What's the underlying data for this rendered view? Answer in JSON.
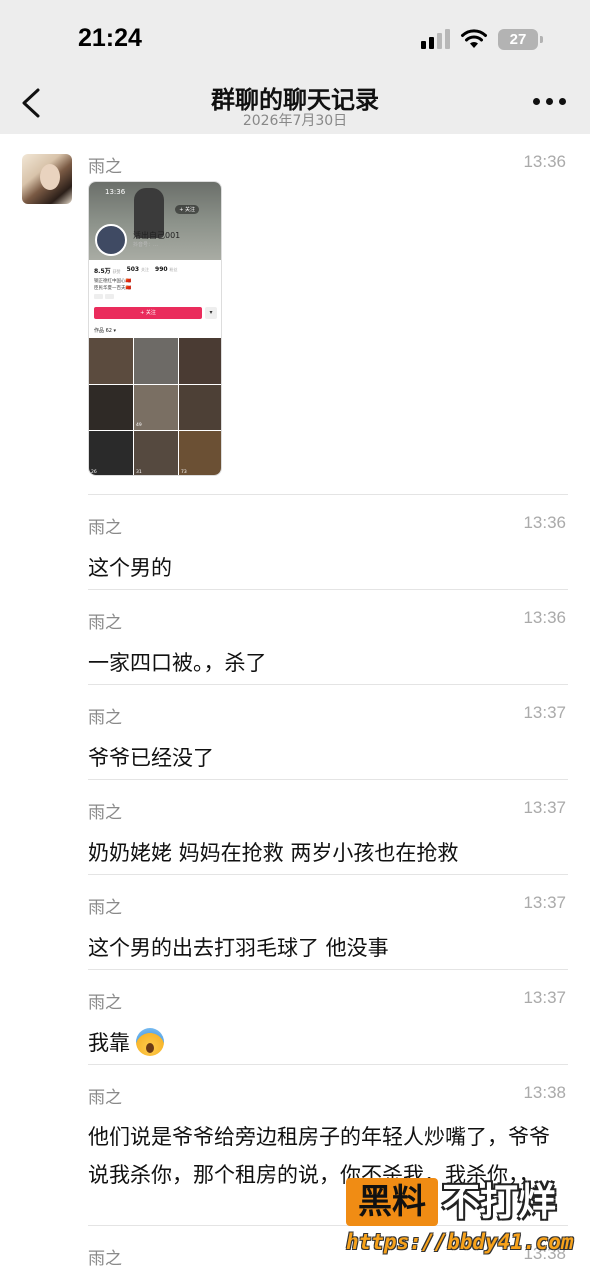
{
  "status_bar": {
    "time": "21:24",
    "battery": "27"
  },
  "header": {
    "title": "群聊的聊天记录",
    "date": "2026年7月30日"
  },
  "messages": [
    {
      "sender": "雨之",
      "time": "13:36",
      "type": "image"
    },
    {
      "sender": "雨之",
      "time": "13:36",
      "text": "这个男的"
    },
    {
      "sender": "雨之",
      "time": "13:36",
      "text": "一家四口被。，杀了"
    },
    {
      "sender": "雨之",
      "time": "13:37",
      "text": "爷爷已经没了"
    },
    {
      "sender": "雨之",
      "time": "13:37",
      "text": "奶奶姥姥 妈妈在抢救 两岁小孩也在抢救"
    },
    {
      "sender": "雨之",
      "time": "13:37",
      "text": "这个男的出去打羽毛球了 他没事"
    },
    {
      "sender": "雨之",
      "time": "13:37",
      "text": "我靠",
      "emoji": "face-screaming-in-fear"
    },
    {
      "sender": "雨之",
      "time": "13:38",
      "text": "他们说是爷爷给旁边租房子的年轻人炒嘴了，爷爷说我杀你，那个租房的说，你不杀我，我杀你，，"
    },
    {
      "sender": "雨之",
      "time": "13:38"
    }
  ],
  "shared_screenshot": {
    "time": "13:36",
    "follow_chip": "+ 关注",
    "name": "活出自己001",
    "id": "抖音号：…",
    "stats": [
      {
        "value": "8.5万",
        "label": "获赞"
      },
      {
        "value": "503",
        "label": "关注"
      },
      {
        "value": "990",
        "label": "粉丝"
      }
    ],
    "bio_line1": "钢正德红中国心🇨🇳",
    "bio_line2": "臣民华夏一百夫🇨🇳",
    "follow_button": "+ 关注",
    "works_label": "作品 62 ▾",
    "grid_likes": [
      "",
      "",
      "",
      "",
      "49",
      "",
      "26",
      "31",
      "73"
    ]
  },
  "watermark": {
    "badge": "黑料",
    "text": "不打烊",
    "url": "https://bbdy41.com"
  },
  "colors": {
    "header_bg": "#ededed",
    "follow_red": "#ea2c5c",
    "watermark_orange": "#f08c14"
  }
}
